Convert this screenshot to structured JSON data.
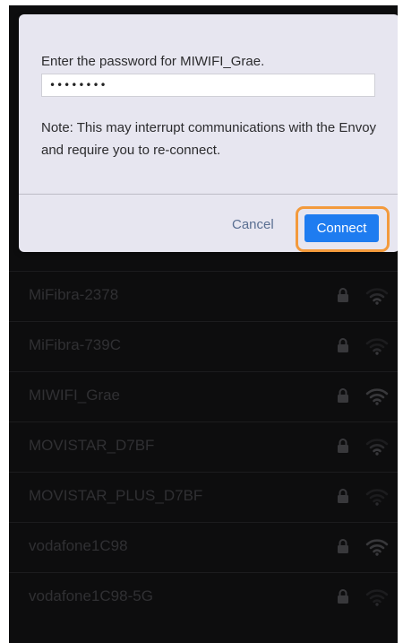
{
  "dialog": {
    "prompt": "Enter the password for MIWIFI_Grae.",
    "password_value": "••••••••",
    "note": "Note: This may interrupt communications with the Envoy and require you to re-connect.",
    "cancel_label": "Cancel",
    "connect_label": "Connect"
  },
  "colors": {
    "accent": "#1e7cf0",
    "highlight": "#f39a3c",
    "cancel_text": "#5a6f92"
  },
  "networks": [
    {
      "name": "MiFibra-2378",
      "icon_lock": "lock-icon",
      "icon_signal": "wifi-signal-icon"
    },
    {
      "name": "MiFibra-739C",
      "icon_lock": "lock-icon",
      "icon_signal": "wifi-signal-icon"
    },
    {
      "name": "MIWIFI_Grae",
      "icon_lock": "lock-icon",
      "icon_signal": "wifi-signal-icon"
    },
    {
      "name": "MOVISTAR_D7BF",
      "icon_lock": "lock-icon",
      "icon_signal": "wifi-signal-icon"
    },
    {
      "name": "MOVISTAR_PLUS_D7BF",
      "icon_lock": "lock-icon",
      "icon_signal": "wifi-signal-icon"
    },
    {
      "name": "vodafone1C98",
      "icon_lock": "lock-icon",
      "icon_signal": "wifi-signal-icon"
    },
    {
      "name": "vodafone1C98-5G",
      "icon_lock": "lock-icon",
      "icon_signal": "wifi-signal-icon"
    }
  ]
}
